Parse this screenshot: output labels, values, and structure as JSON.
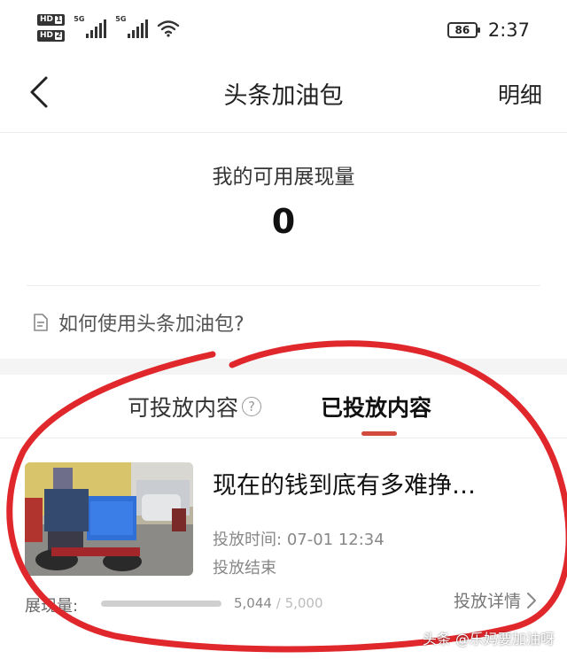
{
  "status_bar": {
    "sim1_badge": "HD",
    "sim1_num": "1",
    "sim2_badge": "HD",
    "sim2_num": "2",
    "network1": "5G",
    "network2": "5G",
    "battery": "86",
    "time": "2:37"
  },
  "nav": {
    "back_icon": "chevron-left-icon",
    "title": "头条加油包",
    "detail_label": "明细"
  },
  "impressions": {
    "label": "我的可用展现量",
    "value": "0"
  },
  "help": {
    "icon": "document-icon",
    "text": "如何使用头条加油包?"
  },
  "tabs": [
    {
      "label": "可投放内容",
      "icon": "question-circle-icon",
      "active": false
    },
    {
      "label": "已投放内容",
      "active": true
    }
  ],
  "card": {
    "title": "现在的钱到底有多难挣…",
    "time_label": "投放时间:",
    "time": "07-01 12:34",
    "status": "投放结束",
    "impressions_label": "展现量:",
    "current": "5,044",
    "separator": "/",
    "total": "5,000",
    "progress": 1.0,
    "detail_label": "投放详情"
  },
  "watermark": "头条 @乐妈要加油呀",
  "colors": {
    "accent": "#d24b3e",
    "annotation": "#e0272b"
  }
}
